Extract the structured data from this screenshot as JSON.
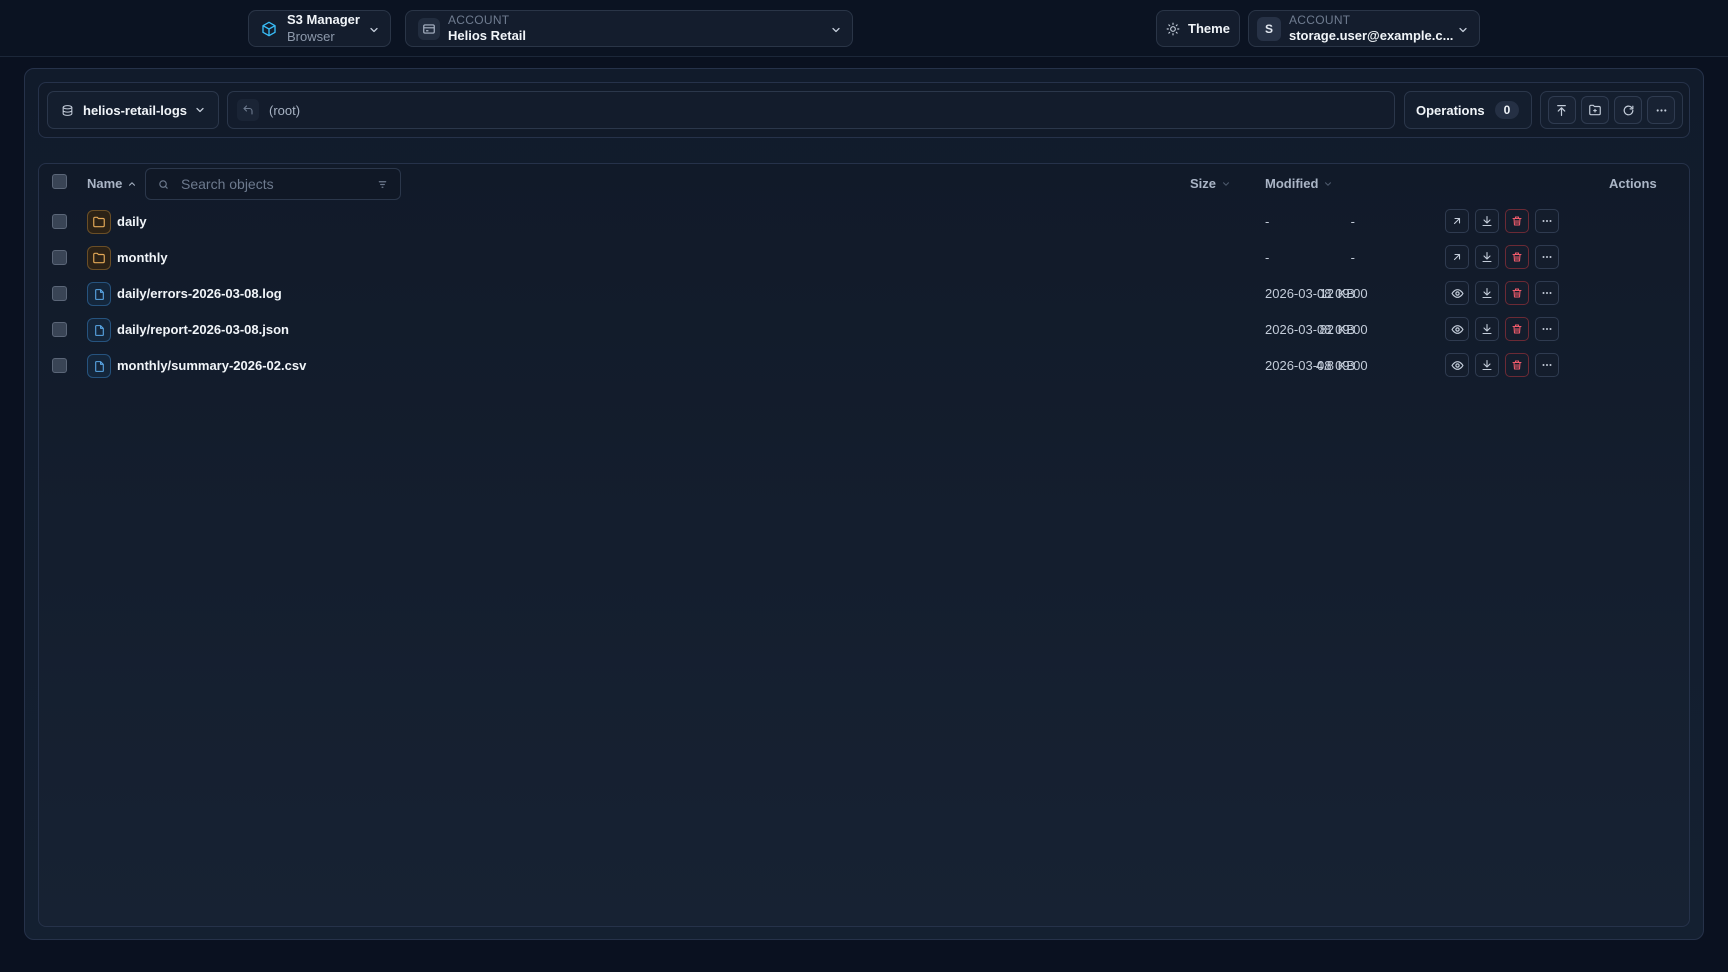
{
  "header": {
    "app": {
      "title": "S3 Manager",
      "subtitle": "Browser"
    },
    "account": {
      "caption": "ACCOUNT",
      "name": "Helios Retail"
    },
    "theme_label": "Theme",
    "user": {
      "initial": "S",
      "caption": "ACCOUNT",
      "email": "storage.user@example.c..."
    }
  },
  "toolbar": {
    "bucket": "helios-retail-logs",
    "path": "(root)",
    "operations_label": "Operations",
    "operations_count": "0",
    "tools": [
      "upload-icon",
      "new-folder-icon",
      "refresh-icon",
      "more-icon"
    ]
  },
  "table": {
    "columns": {
      "name": "Name",
      "size": "Size",
      "modified": "Modified",
      "actions": "Actions"
    },
    "search_placeholder": "Search objects",
    "rows": [
      {
        "type": "folder",
        "name": "daily",
        "size": "-",
        "modified": "-"
      },
      {
        "type": "folder",
        "name": "monthly",
        "size": "-",
        "modified": "-"
      },
      {
        "type": "file",
        "name": "daily/errors-2026-03-08.log",
        "size": "12 KB",
        "modified": "2026-03-08 09:00"
      },
      {
        "type": "file",
        "name": "daily/report-2026-03-08.json",
        "size": "82 KB",
        "modified": "2026-03-08 09:00"
      },
      {
        "type": "file",
        "name": "monthly/summary-2026-02.csv",
        "size": "4.8 KB",
        "modified": "2026-03-08 09:00"
      }
    ]
  },
  "colors": {
    "background": "#0a1120",
    "accent": "#38bdf8",
    "folder": "#e3a857",
    "file": "#5aa8e8",
    "danger": "#ef5b6b"
  }
}
